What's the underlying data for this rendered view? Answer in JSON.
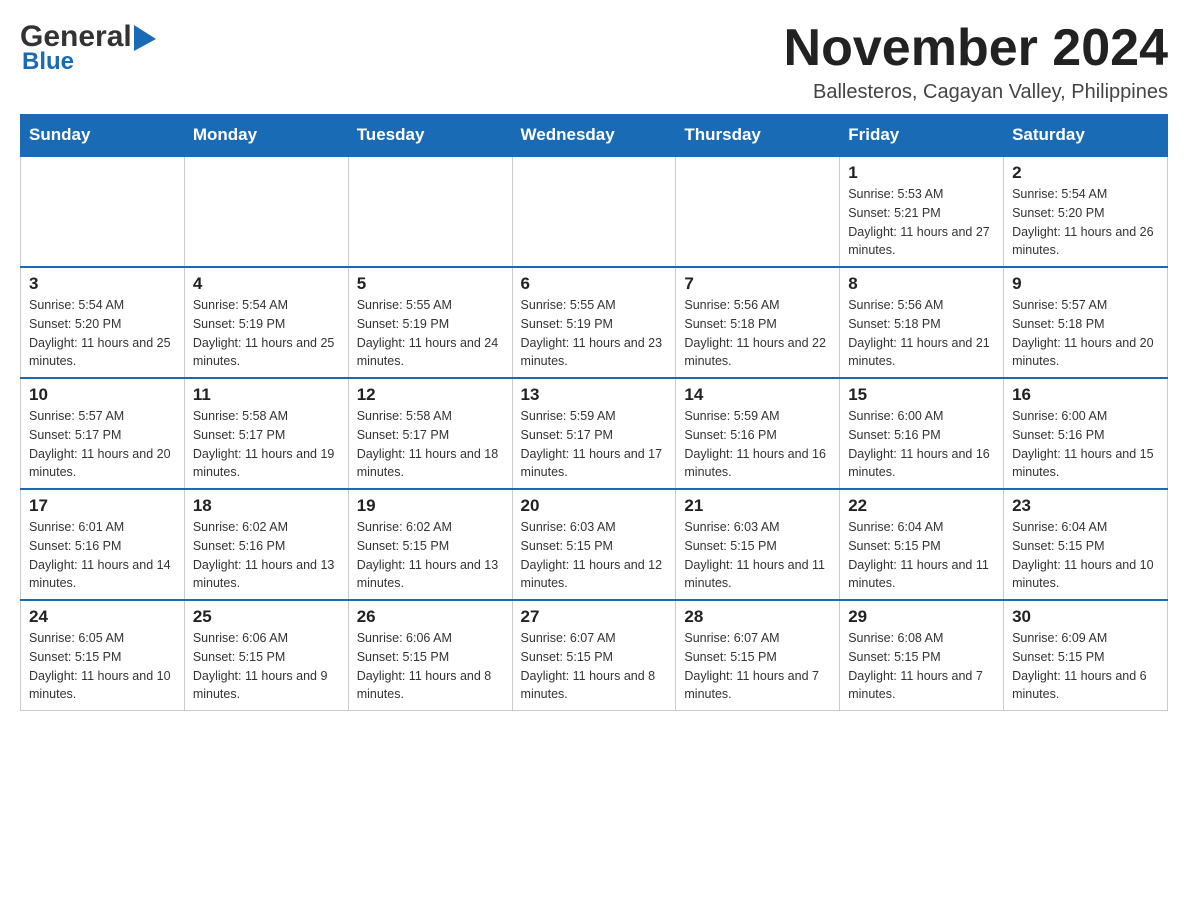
{
  "header": {
    "logo_general": "General",
    "logo_blue": "Blue",
    "month_title": "November 2024",
    "location": "Ballesteros, Cagayan Valley, Philippines"
  },
  "days_of_week": [
    "Sunday",
    "Monday",
    "Tuesday",
    "Wednesday",
    "Thursday",
    "Friday",
    "Saturday"
  ],
  "weeks": [
    [
      {
        "day": "",
        "info": ""
      },
      {
        "day": "",
        "info": ""
      },
      {
        "day": "",
        "info": ""
      },
      {
        "day": "",
        "info": ""
      },
      {
        "day": "",
        "info": ""
      },
      {
        "day": "1",
        "info": "Sunrise: 5:53 AM\nSunset: 5:21 PM\nDaylight: 11 hours and 27 minutes."
      },
      {
        "day": "2",
        "info": "Sunrise: 5:54 AM\nSunset: 5:20 PM\nDaylight: 11 hours and 26 minutes."
      }
    ],
    [
      {
        "day": "3",
        "info": "Sunrise: 5:54 AM\nSunset: 5:20 PM\nDaylight: 11 hours and 25 minutes."
      },
      {
        "day": "4",
        "info": "Sunrise: 5:54 AM\nSunset: 5:19 PM\nDaylight: 11 hours and 25 minutes."
      },
      {
        "day": "5",
        "info": "Sunrise: 5:55 AM\nSunset: 5:19 PM\nDaylight: 11 hours and 24 minutes."
      },
      {
        "day": "6",
        "info": "Sunrise: 5:55 AM\nSunset: 5:19 PM\nDaylight: 11 hours and 23 minutes."
      },
      {
        "day": "7",
        "info": "Sunrise: 5:56 AM\nSunset: 5:18 PM\nDaylight: 11 hours and 22 minutes."
      },
      {
        "day": "8",
        "info": "Sunrise: 5:56 AM\nSunset: 5:18 PM\nDaylight: 11 hours and 21 minutes."
      },
      {
        "day": "9",
        "info": "Sunrise: 5:57 AM\nSunset: 5:18 PM\nDaylight: 11 hours and 20 minutes."
      }
    ],
    [
      {
        "day": "10",
        "info": "Sunrise: 5:57 AM\nSunset: 5:17 PM\nDaylight: 11 hours and 20 minutes."
      },
      {
        "day": "11",
        "info": "Sunrise: 5:58 AM\nSunset: 5:17 PM\nDaylight: 11 hours and 19 minutes."
      },
      {
        "day": "12",
        "info": "Sunrise: 5:58 AM\nSunset: 5:17 PM\nDaylight: 11 hours and 18 minutes."
      },
      {
        "day": "13",
        "info": "Sunrise: 5:59 AM\nSunset: 5:17 PM\nDaylight: 11 hours and 17 minutes."
      },
      {
        "day": "14",
        "info": "Sunrise: 5:59 AM\nSunset: 5:16 PM\nDaylight: 11 hours and 16 minutes."
      },
      {
        "day": "15",
        "info": "Sunrise: 6:00 AM\nSunset: 5:16 PM\nDaylight: 11 hours and 16 minutes."
      },
      {
        "day": "16",
        "info": "Sunrise: 6:00 AM\nSunset: 5:16 PM\nDaylight: 11 hours and 15 minutes."
      }
    ],
    [
      {
        "day": "17",
        "info": "Sunrise: 6:01 AM\nSunset: 5:16 PM\nDaylight: 11 hours and 14 minutes."
      },
      {
        "day": "18",
        "info": "Sunrise: 6:02 AM\nSunset: 5:16 PM\nDaylight: 11 hours and 13 minutes."
      },
      {
        "day": "19",
        "info": "Sunrise: 6:02 AM\nSunset: 5:15 PM\nDaylight: 11 hours and 13 minutes."
      },
      {
        "day": "20",
        "info": "Sunrise: 6:03 AM\nSunset: 5:15 PM\nDaylight: 11 hours and 12 minutes."
      },
      {
        "day": "21",
        "info": "Sunrise: 6:03 AM\nSunset: 5:15 PM\nDaylight: 11 hours and 11 minutes."
      },
      {
        "day": "22",
        "info": "Sunrise: 6:04 AM\nSunset: 5:15 PM\nDaylight: 11 hours and 11 minutes."
      },
      {
        "day": "23",
        "info": "Sunrise: 6:04 AM\nSunset: 5:15 PM\nDaylight: 11 hours and 10 minutes."
      }
    ],
    [
      {
        "day": "24",
        "info": "Sunrise: 6:05 AM\nSunset: 5:15 PM\nDaylight: 11 hours and 10 minutes."
      },
      {
        "day": "25",
        "info": "Sunrise: 6:06 AM\nSunset: 5:15 PM\nDaylight: 11 hours and 9 minutes."
      },
      {
        "day": "26",
        "info": "Sunrise: 6:06 AM\nSunset: 5:15 PM\nDaylight: 11 hours and 8 minutes."
      },
      {
        "day": "27",
        "info": "Sunrise: 6:07 AM\nSunset: 5:15 PM\nDaylight: 11 hours and 8 minutes."
      },
      {
        "day": "28",
        "info": "Sunrise: 6:07 AM\nSunset: 5:15 PM\nDaylight: 11 hours and 7 minutes."
      },
      {
        "day": "29",
        "info": "Sunrise: 6:08 AM\nSunset: 5:15 PM\nDaylight: 11 hours and 7 minutes."
      },
      {
        "day": "30",
        "info": "Sunrise: 6:09 AM\nSunset: 5:15 PM\nDaylight: 11 hours and 6 minutes."
      }
    ]
  ]
}
